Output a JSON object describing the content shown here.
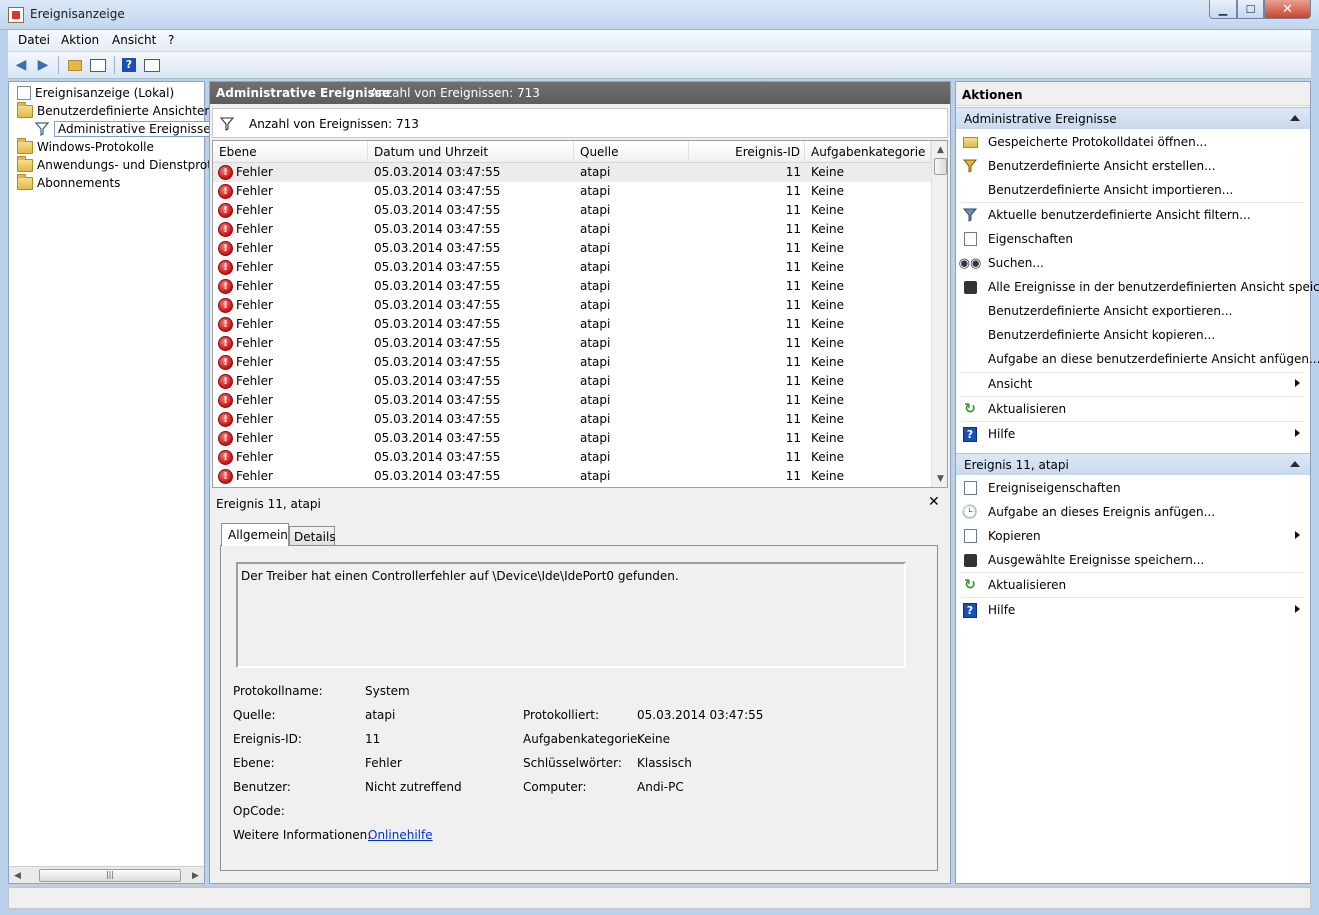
{
  "window": {
    "title": "Ereignisanzeige"
  },
  "menu": [
    "Datei",
    "Aktion",
    "Ansicht",
    "?"
  ],
  "tree": {
    "root": "Ereignisanzeige (Lokal)",
    "custom_views": "Benutzerdefinierte Ansichten",
    "admin_events": "Administrative Ereignisse",
    "windows_logs": "Windows-Protokolle",
    "app_logs": "Anwendungs- und Dienstproto",
    "subscriptions": "Abonnements"
  },
  "center": {
    "title": "Administrative Ereignisse",
    "count": "Anzahl von Ereignissen: 713",
    "filter_text": "Anzahl von Ereignissen: 713"
  },
  "table": {
    "columns": [
      "Ebene",
      "Datum und Uhrzeit",
      "Quelle",
      "Ereignis-ID",
      "Aufgabenkategorie"
    ],
    "rows": [
      [
        "Fehler",
        "05.03.2014 03:47:55",
        "atapi",
        "11",
        "Keine"
      ],
      [
        "Fehler",
        "05.03.2014 03:47:55",
        "atapi",
        "11",
        "Keine"
      ],
      [
        "Fehler",
        "05.03.2014 03:47:55",
        "atapi",
        "11",
        "Keine"
      ],
      [
        "Fehler",
        "05.03.2014 03:47:55",
        "atapi",
        "11",
        "Keine"
      ],
      [
        "Fehler",
        "05.03.2014 03:47:55",
        "atapi",
        "11",
        "Keine"
      ],
      [
        "Fehler",
        "05.03.2014 03:47:55",
        "atapi",
        "11",
        "Keine"
      ],
      [
        "Fehler",
        "05.03.2014 03:47:55",
        "atapi",
        "11",
        "Keine"
      ],
      [
        "Fehler",
        "05.03.2014 03:47:55",
        "atapi",
        "11",
        "Keine"
      ],
      [
        "Fehler",
        "05.03.2014 03:47:55",
        "atapi",
        "11",
        "Keine"
      ],
      [
        "Fehler",
        "05.03.2014 03:47:55",
        "atapi",
        "11",
        "Keine"
      ],
      [
        "Fehler",
        "05.03.2014 03:47:55",
        "atapi",
        "11",
        "Keine"
      ],
      [
        "Fehler",
        "05.03.2014 03:47:55",
        "atapi",
        "11",
        "Keine"
      ],
      [
        "Fehler",
        "05.03.2014 03:47:55",
        "atapi",
        "11",
        "Keine"
      ],
      [
        "Fehler",
        "05.03.2014 03:47:55",
        "atapi",
        "11",
        "Keine"
      ],
      [
        "Fehler",
        "05.03.2014 03:47:55",
        "atapi",
        "11",
        "Keine"
      ],
      [
        "Fehler",
        "05.03.2014 03:47:55",
        "atapi",
        "11",
        "Keine"
      ],
      [
        "Fehler",
        "05.03.2014 03:47:55",
        "atapi",
        "11",
        "Keine"
      ]
    ]
  },
  "detail": {
    "title": "Ereignis 11, atapi",
    "tabs": [
      "Allgemein",
      "Details"
    ],
    "description": "Der Treiber hat einen Controllerfehler auf \\Device\\Ide\\IdePort0 gefunden.",
    "fields": {
      "log_name_label": "Protokollname:",
      "log_name": "System",
      "source_label": "Quelle:",
      "source": "atapi",
      "logged_label": "Protokolliert:",
      "logged": "05.03.2014 03:47:55",
      "event_id_label": "Ereignis-ID:",
      "event_id": "11",
      "task_label": "Aufgabenkategorie:",
      "task": "Keine",
      "level_label": "Ebene:",
      "level": "Fehler",
      "keywords_label": "Schlüsselwörter:",
      "keywords": "Klassisch",
      "user_label": "Benutzer:",
      "user": "Nicht zutreffend",
      "computer_label": "Computer:",
      "computer": "Andi-PC",
      "opcode_label": "OpCode:",
      "more_info_label": "Weitere Informationen:",
      "more_info_link": "Onlinehilfe"
    }
  },
  "actions": {
    "header": "Aktionen",
    "section1": {
      "title": "Administrative Ereignisse",
      "items": [
        "Gespeicherte Protokolldatei öffnen...",
        "Benutzerdefinierte Ansicht erstellen...",
        "Benutzerdefinierte Ansicht importieren...",
        "Aktuelle benutzerdefinierte Ansicht filtern...",
        "Eigenschaften",
        "Suchen...",
        "Alle Ereignisse in der benutzerdefinierten Ansicht speic...",
        "Benutzerdefinierte Ansicht exportieren...",
        "Benutzerdefinierte Ansicht kopieren...",
        "Aufgabe an diese benutzerdefinierte Ansicht anfügen...",
        "Ansicht",
        "Aktualisieren",
        "Hilfe"
      ]
    },
    "section2": {
      "title": "Ereignis 11, atapi",
      "items": [
        "Ereigniseigenschaften",
        "Aufgabe an dieses Ereignis anfügen...",
        "Kopieren",
        "Ausgewählte Ereignisse speichern...",
        "Aktualisieren",
        "Hilfe"
      ]
    }
  }
}
